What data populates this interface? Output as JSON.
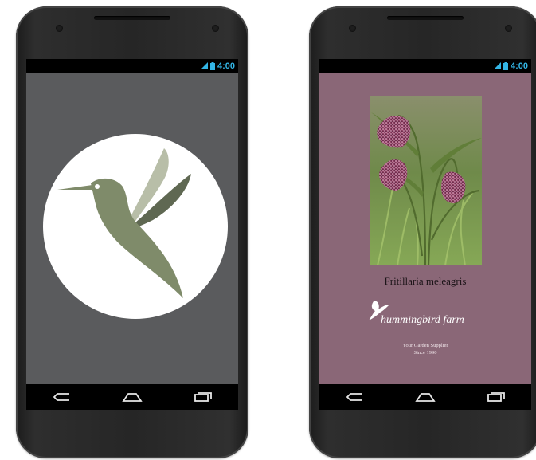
{
  "status_bar": {
    "time": "4:00"
  },
  "left_phone": {
    "screen": "splash",
    "logo_icon": "hummingbird-icon"
  },
  "right_phone": {
    "plant_name": "Fritillaria meleagris",
    "brand": {
      "name": "hummingbird farm",
      "tagline": "Your Garden Supplier",
      "since": "Since 1990"
    }
  },
  "nav_buttons": [
    "back",
    "home",
    "recent-apps"
  ],
  "colors": {
    "splash_bg": "#5a5b5d",
    "bird_green": "#7f8b6a",
    "plant_bg": "#8a6777",
    "status_accent": "#33b5e5"
  }
}
